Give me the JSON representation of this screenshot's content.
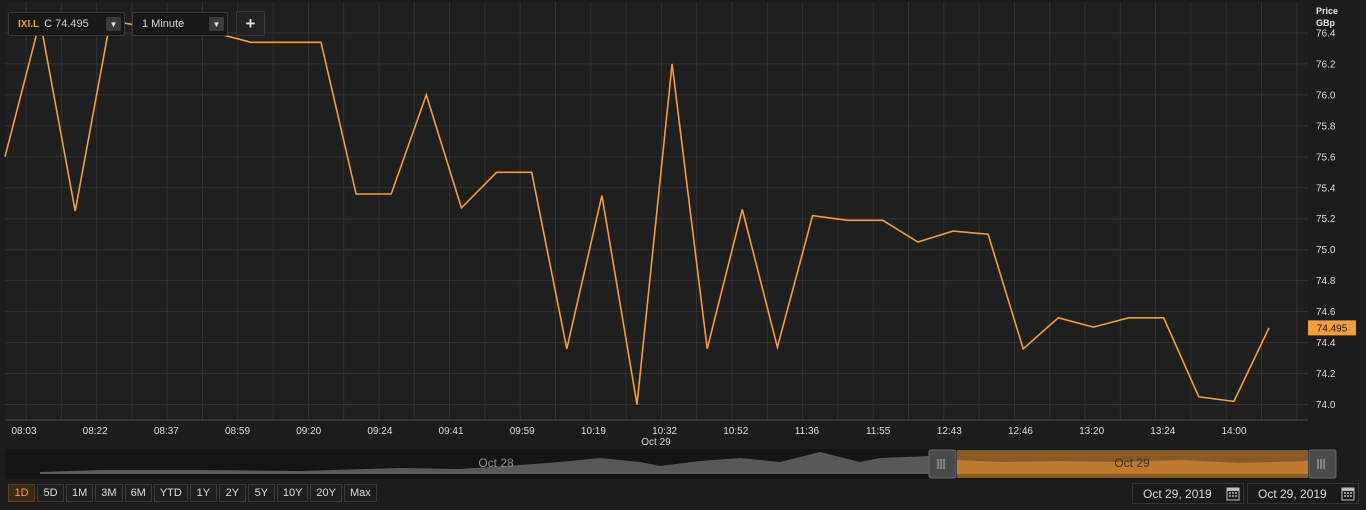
{
  "toolbar": {
    "symbol": "IXI.L",
    "close_label": "C 74.495",
    "interval": "1 Minute",
    "add_label": "+"
  },
  "axis": {
    "unit_line1": "Price",
    "unit_line2": "GBp",
    "last_price_label": "74.495"
  },
  "navigator": {
    "label_left": "Oct 28",
    "label_right": "Oct 29"
  },
  "range_buttons": [
    "1D",
    "5D",
    "1M",
    "3M",
    "6M",
    "YTD",
    "1Y",
    "2Y",
    "5Y",
    "10Y",
    "20Y",
    "Max"
  ],
  "active_range": "1D",
  "dates": {
    "from": "Oct 29, 2019",
    "to": "Oct 29, 2019"
  },
  "colors": {
    "line": "#f39d3c",
    "background": "#1c1c1c",
    "grid": "#333333"
  },
  "icons": {
    "dropdown": "triangle-down-icon",
    "calendar": "calendar-icon",
    "navigator_handle": "grip-icon"
  },
  "chart_data": {
    "type": "line",
    "title": "",
    "xlabel": "",
    "ylabel": "Price GBp",
    "ylim": [
      73.9,
      76.6
    ],
    "y_ticks": [
      74.0,
      74.2,
      74.4,
      74.6,
      74.8,
      75.0,
      75.2,
      75.4,
      75.6,
      75.8,
      76.0,
      76.2,
      76.4
    ],
    "x_tick_labels": [
      "08:03",
      "08:22",
      "08:37",
      "08:59",
      "09:20",
      "09:24",
      "09:41",
      "09:59",
      "10:19",
      "10:32",
      "10:52",
      "11:36",
      "11:55",
      "12:43",
      "12:46",
      "13:20",
      "13:24",
      "14:00"
    ],
    "x_date_label": "Oct 29",
    "grid": true,
    "last_value": 74.495,
    "series": [
      {
        "values": [
          75.6,
          76.48,
          75.25,
          76.48,
          76.44,
          76.48,
          76.4,
          76.34,
          76.34,
          76.34,
          75.36,
          75.36,
          76.0,
          75.27,
          75.5,
          75.5,
          74.36,
          75.35,
          74.0,
          76.2,
          74.36,
          75.26,
          74.37,
          75.22,
          75.19,
          75.19,
          75.05,
          75.12,
          75.1,
          74.36,
          74.56,
          74.5,
          74.56,
          74.56,
          74.05,
          74.02,
          74.495
        ]
      }
    ]
  }
}
